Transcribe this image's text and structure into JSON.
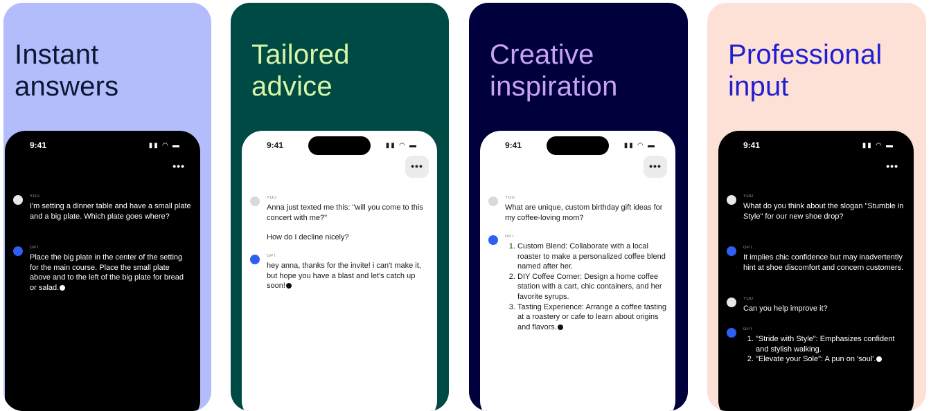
{
  "panels": [
    {
      "headline": [
        "Instant",
        "answers"
      ],
      "status_time": "9:41",
      "messages": [
        {
          "sender": "YOU",
          "lines": [
            "I'm setting a dinner table and have a small plate and a big plate. Which plate goes where?"
          ]
        },
        {
          "sender": "GPT",
          "lines": [
            "Place the big plate in the center of the setting for the main course. Place the small plate above and to the left of the big plate for bread or salad."
          ]
        }
      ]
    },
    {
      "headline": [
        "Tailored",
        "advice"
      ],
      "status_time": "9:41",
      "messages": [
        {
          "sender": "YOU",
          "lines": [
            "Anna just texted me this: \"will you come to this concert with me?\"",
            "How do I decline nicely?"
          ]
        },
        {
          "sender": "GPT",
          "lines": [
            "hey anna, thanks for the invite! i can't make it, but hope you have a blast and let's catch up soon!"
          ]
        }
      ]
    },
    {
      "headline": [
        "Creative",
        "inspiration"
      ],
      "status_time": "9:41",
      "messages": [
        {
          "sender": "YOU",
          "lines": [
            "What are unique, custom birthday gift ideas for my coffee-loving mom?"
          ]
        },
        {
          "sender": "GPT",
          "list": [
            "Custom Blend: Collaborate with a local roaster to make a personalized coffee blend named after her.",
            "DIY Coffee Corner: Design a home coffee station with a cart, chic containers, and her favorite syrups.",
            "Tasting Experience: Arrange a coffee tasting at a roastery or cafe to learn about origins and flavors."
          ]
        }
      ]
    },
    {
      "headline": [
        "Professional",
        "input"
      ],
      "status_time": "9:41",
      "messages": [
        {
          "sender": "YOU",
          "lines": [
            "What do you think about the slogan \"Stumble in Style\" for our new shoe drop?"
          ]
        },
        {
          "sender": "GPT",
          "lines": [
            "It implies chic confidence but may inadvertently hint at shoe discomfort and concern customers."
          ]
        },
        {
          "sender": "YOU",
          "lines": [
            "Can you help improve it?"
          ]
        },
        {
          "sender": "GPT",
          "list": [
            "\"Stride with Style\": Emphasizes confident and stylish walking.",
            "\"Elevate your Sole\": A pun on 'soul'."
          ]
        }
      ]
    }
  ],
  "status_icons": "signal-wifi-battery",
  "more_label": "•••",
  "colors": {
    "panel1_bg": "#b3bdfb",
    "panel1_headline": "#0b1733",
    "panel2_bg": "#004a45",
    "panel2_headline": "#d8f5a8",
    "panel3_bg": "#00003c",
    "panel3_headline": "#c9a3f2",
    "panel4_bg": "#fde0d6",
    "panel4_headline": "#1f1fd1",
    "gpt_avatar": "#2f5ef2"
  }
}
